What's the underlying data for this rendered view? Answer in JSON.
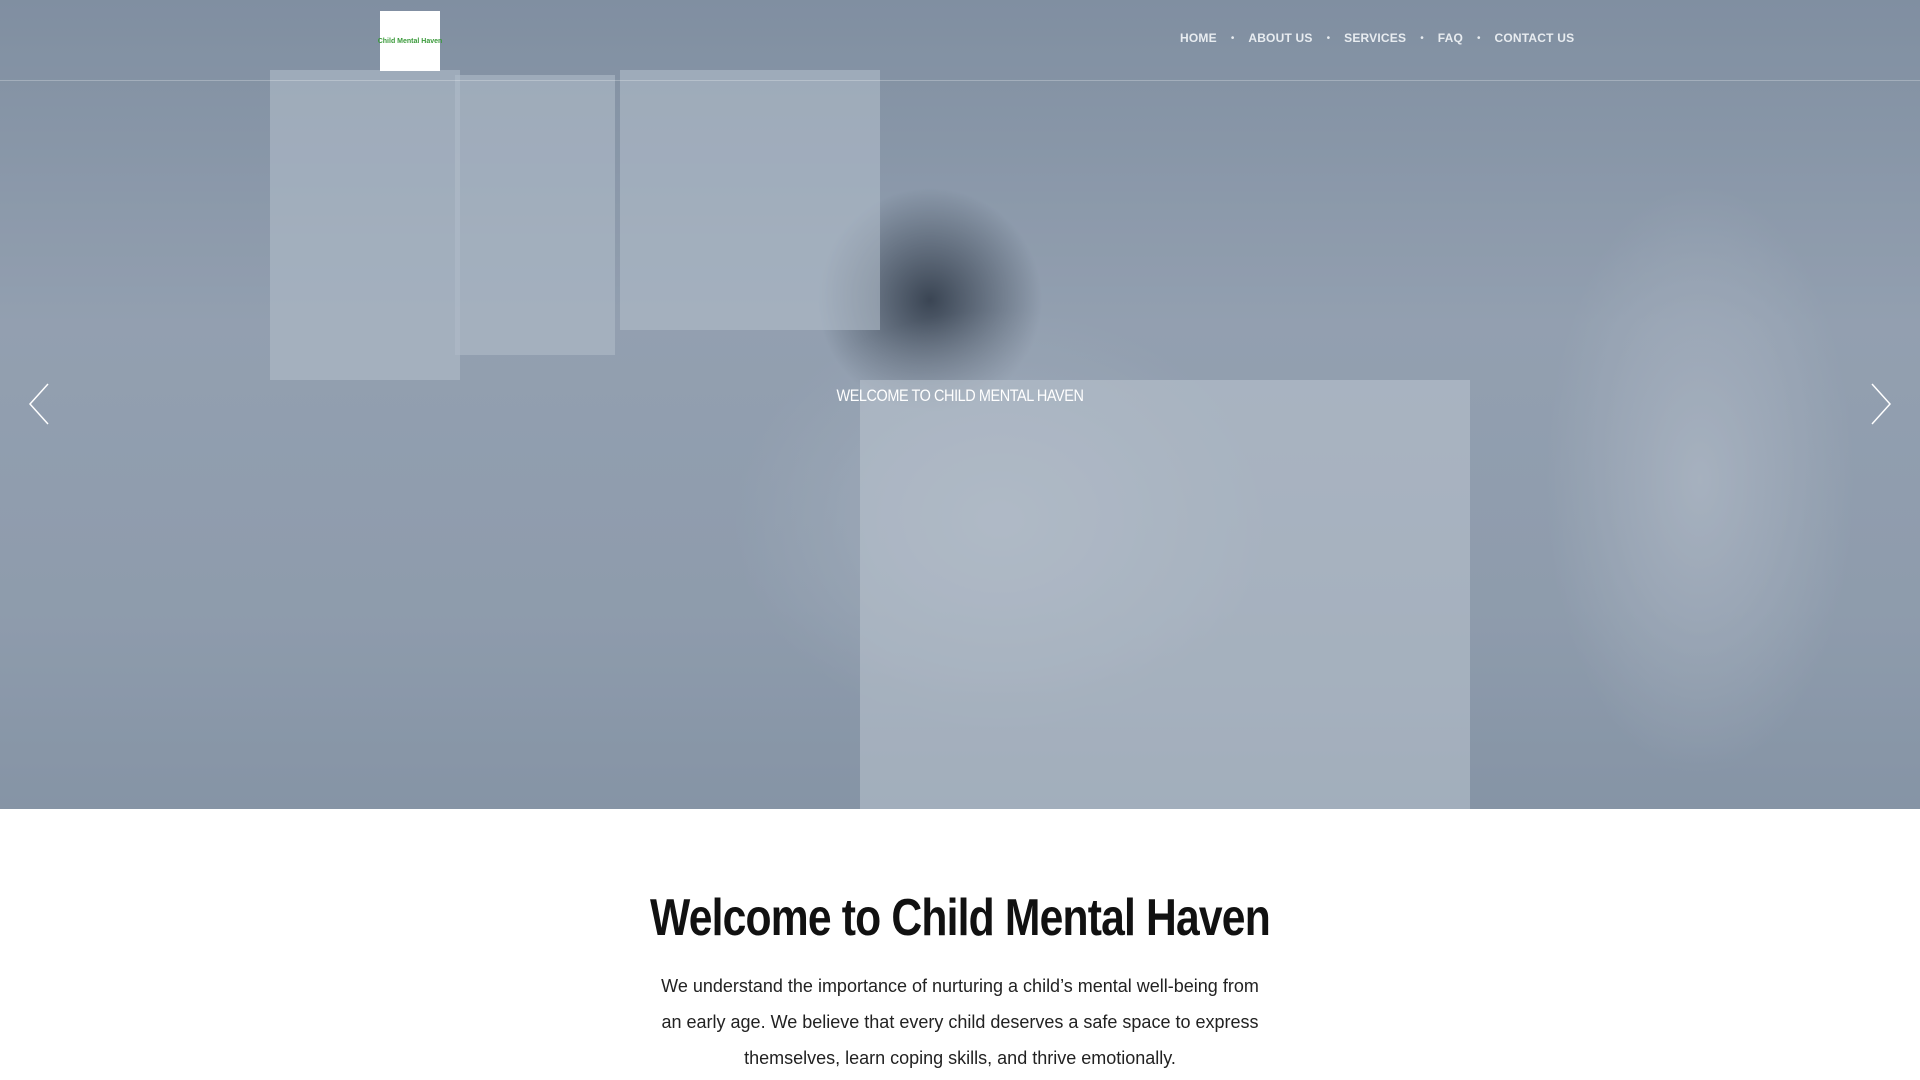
{
  "header": {
    "logo_text": "Child Mental Haven",
    "nav": [
      {
        "label": "HOME"
      },
      {
        "label": "ABOUT US"
      },
      {
        "label": "SERVICES"
      },
      {
        "label": "FAQ"
      },
      {
        "label": "CONTACT US"
      }
    ]
  },
  "hero": {
    "caption": "WELCOME TO CHILD MENTAL HAVEN",
    "prev_icon": "chevron-left-icon",
    "next_icon": "chevron-right-icon"
  },
  "main": {
    "title": "Welcome to Child Mental Haven",
    "intro": "We understand the importance of nurturing a child’s mental well-being from an early age. We believe that every child deserves a safe space to express themselves, learn coping skills, and thrive emotionally."
  }
}
